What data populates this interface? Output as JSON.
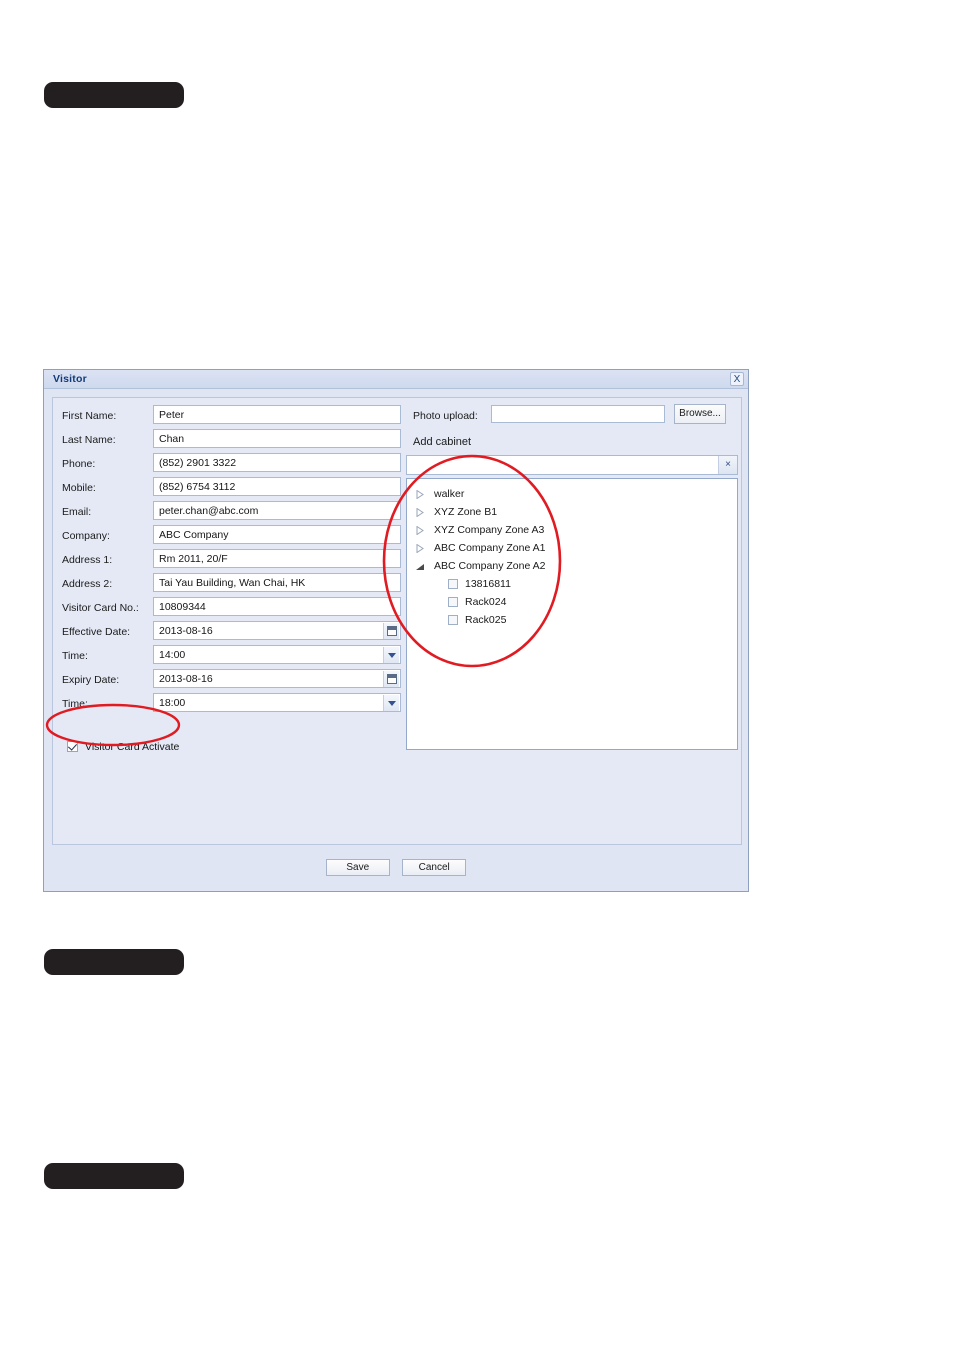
{
  "redactions": [
    {
      "name": "redaction-bar-top"
    },
    {
      "name": "redaction-bar-middle"
    },
    {
      "name": "redaction-bar-bottom"
    }
  ],
  "dialog": {
    "title": "Visitor",
    "close_label": "X",
    "form_fields": [
      {
        "label": "First Name:",
        "value": "Peter",
        "trigger": "none"
      },
      {
        "label": "Last Name:",
        "value": "Chan",
        "trigger": "none"
      },
      {
        "label": "Phone:",
        "value": "(852) 2901 3322",
        "trigger": "none"
      },
      {
        "label": "Mobile:",
        "value": "(852) 6754 3112",
        "trigger": "none"
      },
      {
        "label": "Email:",
        "value": "peter.chan@abc.com",
        "trigger": "none"
      },
      {
        "label": "Company:",
        "value": "ABC Company",
        "trigger": "none"
      },
      {
        "label": "Address 1:",
        "value": "Rm 2011, 20/F",
        "trigger": "none"
      },
      {
        "label": "Address 2:",
        "value": "Tai Yau Building, Wan Chai, HK",
        "trigger": "none"
      },
      {
        "label": "Visitor Card No.:",
        "value": "10809344",
        "trigger": "none"
      },
      {
        "label": "Effective Date:",
        "value": "2013-08-16",
        "trigger": "calendar"
      },
      {
        "label": "Time:",
        "value": "14:00",
        "trigger": "chevron"
      },
      {
        "label": "Expiry Date:",
        "value": "2013-08-16",
        "trigger": "calendar"
      },
      {
        "label": "Time:",
        "value": "18:00",
        "trigger": "chevron"
      }
    ],
    "activate_checkbox": {
      "label": "Visitor Card Activate",
      "checked": true
    },
    "photo_upload": {
      "label": "Photo upload:",
      "value": "",
      "browse_label": "Browse..."
    },
    "add_cabinet": {
      "label": "Add cabinet",
      "search_value": "",
      "clear_label": "×",
      "tree": [
        {
          "kind": "node",
          "label": "walker",
          "expanded": false
        },
        {
          "kind": "node",
          "label": "XYZ Zone B1",
          "expanded": false
        },
        {
          "kind": "node",
          "label": "XYZ Company Zone A3",
          "expanded": false
        },
        {
          "kind": "node",
          "label": "ABC Company Zone A1",
          "expanded": false
        },
        {
          "kind": "node",
          "label": "ABC Company Zone A2",
          "expanded": true
        },
        {
          "kind": "leaf",
          "label": "13816811",
          "checked": false
        },
        {
          "kind": "leaf",
          "label": "Rack024",
          "checked": false
        },
        {
          "kind": "leaf",
          "label": "Rack025",
          "checked": false
        }
      ]
    },
    "footer": {
      "save_label": "Save",
      "cancel_label": "Cancel"
    }
  },
  "annotations": {
    "accent_color": "#e01b22",
    "circle_tree_name": "highlight-circle-cabinet-tree",
    "ellipse_checkbox_name": "highlight-ellipse-visitor-card-activate"
  },
  "colors": {
    "dialog_title_text": "#123a7a",
    "dialog_chrome": "#dfe5f2",
    "dialog_body": "#e4e9f5",
    "field_border": "#a9bad4",
    "annotation_red": "#e01b22"
  }
}
